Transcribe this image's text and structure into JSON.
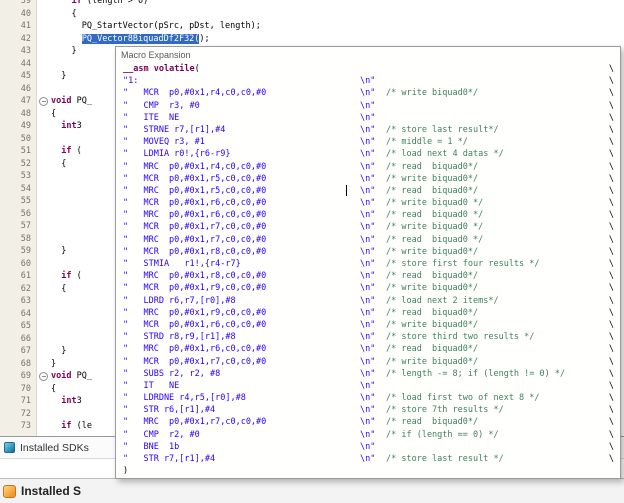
{
  "colors": {
    "keyword": "#7F0055",
    "string": "#2A00FF",
    "comment": "#3F7F5F",
    "selection": "#316AC5",
    "selection_text": "#FFFFFF"
  },
  "editor": {
    "lines": [
      {
        "n": 39,
        "seg": [
          [
            "    "
          ],
          [
            "if",
            "kw"
          ],
          [
            " (length > 0)"
          ]
        ]
      },
      {
        "n": 40,
        "seg": [
          [
            "    {"
          ]
        ]
      },
      {
        "n": 41,
        "seg": [
          [
            "      PQ_StartVector(pSrc, pDst, length);"
          ]
        ]
      },
      {
        "n": 42,
        "seg": [
          [
            "      "
          ],
          [
            "PQ_Vector8BiquadDf2F32(",
            "sel"
          ],
          [
            ");"
          ]
        ]
      },
      {
        "n": 43,
        "seg": [
          [
            "    }"
          ]
        ]
      },
      {
        "n": 44,
        "seg": []
      },
      {
        "n": 45,
        "seg": [
          [
            "  }"
          ]
        ]
      },
      {
        "n": 46,
        "seg": []
      },
      {
        "n": 47,
        "fold": true,
        "seg": [
          [
            "void",
            "kw"
          ],
          [
            " PQ_"
          ]
        ]
      },
      {
        "n": 48,
        "seg": [
          [
            "{"
          ]
        ]
      },
      {
        "n": 49,
        "seg": [
          [
            "  "
          ],
          [
            "int",
            "kw"
          ],
          [
            "3"
          ]
        ]
      },
      {
        "n": 50,
        "seg": []
      },
      {
        "n": 51,
        "seg": [
          [
            "  "
          ],
          [
            "if",
            "kw"
          ],
          [
            " ("
          ]
        ]
      },
      {
        "n": 52,
        "seg": [
          [
            "  {"
          ]
        ]
      },
      {
        "n": 53,
        "seg": []
      },
      {
        "n": 54,
        "seg": []
      },
      {
        "n": 55,
        "seg": []
      },
      {
        "n": 56,
        "seg": []
      },
      {
        "n": 57,
        "seg": []
      },
      {
        "n": 58,
        "seg": []
      },
      {
        "n": 59,
        "seg": [
          [
            "  }"
          ]
        ]
      },
      {
        "n": 60,
        "seg": []
      },
      {
        "n": 61,
        "seg": [
          [
            "  "
          ],
          [
            "if",
            "kw"
          ],
          [
            " ("
          ]
        ]
      },
      {
        "n": 62,
        "seg": [
          [
            "  {"
          ]
        ]
      },
      {
        "n": 63,
        "seg": []
      },
      {
        "n": 64,
        "seg": []
      },
      {
        "n": 65,
        "seg": []
      },
      {
        "n": 66,
        "seg": []
      },
      {
        "n": 67,
        "seg": [
          [
            "  }"
          ]
        ]
      },
      {
        "n": 68,
        "seg": [
          [
            "}"
          ]
        ]
      },
      {
        "n": 69,
        "fold": true,
        "seg": [
          [
            "void",
            "kw"
          ],
          [
            " PQ_"
          ]
        ]
      },
      {
        "n": 70,
        "seg": [
          [
            "{"
          ]
        ]
      },
      {
        "n": 71,
        "seg": [
          [
            "  "
          ],
          [
            "int",
            "kw"
          ],
          [
            "3"
          ]
        ]
      },
      {
        "n": 72,
        "seg": []
      },
      {
        "n": 73,
        "seg": [
          [
            "  "
          ],
          [
            "if",
            "kw"
          ],
          [
            " (le"
          ]
        ]
      }
    ]
  },
  "popup": {
    "title": "Macro Expansion",
    "head": {
      "seg": [
        [
          "__asm",
          "kw"
        ],
        [
          " "
        ],
        [
          "volatile",
          "kw"
        ],
        [
          "("
        ]
      ]
    },
    "nl": "\\n\"",
    "cont": "\\",
    "close": ")",
    "lines": [
      {
        "s": "\"1:",
        "c": ""
      },
      {
        "s": "\"   MCR  p0,#0x1,r4,c0,c0,#0",
        "c": "/* write biquad0*/"
      },
      {
        "s": "\"   CMP  r3, #0",
        "c": ""
      },
      {
        "s": "\"   ITE  NE",
        "c": ""
      },
      {
        "s": "\"   STRNE r7,[r1],#4",
        "c": "/* store last result*/"
      },
      {
        "s": "\"   MOVEQ r3, #1",
        "c": "/* middle = 1 */"
      },
      {
        "s": "\"   LDMIA r0!,{r6-r9}",
        "c": "/* load next 4 datas */"
      },
      {
        "s": "\"   MRC  p0,#0x1,r4,c0,c0,#0",
        "c": "/* read  biquad0*/"
      },
      {
        "s": "\"   MCR  p0,#0x1,r5,c0,c0,#0",
        "c": "/* write biquad0*/"
      },
      {
        "s": "\"   MRC  p0,#0x1,r5,c0,c0,#0",
        "c": "/* read  biquad0*/"
      },
      {
        "s": "\"   MCR  p0,#0x1,r6,c0,c0,#0",
        "c": "/* write biquad0 */"
      },
      {
        "s": "\"   MRC  p0,#0x1,r6,c0,c0,#0",
        "c": "/* read  biquad0 */"
      },
      {
        "s": "\"   MCR  p0,#0x1,r7,c0,c0,#0",
        "c": "/* write biquad0 */"
      },
      {
        "s": "\"   MRC  p0,#0x1,r7,c0,c0,#0",
        "c": "/* read  biquad0 */"
      },
      {
        "s": "\"   MCR  p0,#0x1,r8,c0,c0,#0",
        "c": "/* write biquad0*/"
      },
      {
        "s": "\"   STMIA   r1!,{r4-r7}",
        "c": "/* store first four results */"
      },
      {
        "s": "\"   MRC  p0,#0x1,r8,c0,c0,#0",
        "c": "/* read  biquad0*/"
      },
      {
        "s": "\"   MCR  p0,#0x1,r9,c0,c0,#0",
        "c": "/* write biquad0*/"
      },
      {
        "s": "\"   LDRD r6,r7,[r0],#8",
        "c": "/* load next 2 items*/"
      },
      {
        "s": "\"   MRC  p0,#0x1,r9,c0,c0,#0",
        "c": "/* read  biquad0*/"
      },
      {
        "s": "\"   MCR  p0,#0x1,r6,c0,c0,#0",
        "c": "/* write biquad0*/"
      },
      {
        "s": "\"   STRD r8,r9,[r1],#8",
        "c": "/* store third two results */"
      },
      {
        "s": "\"   MRC  p0,#0x1,r6,c0,c0,#0",
        "c": "/* read  biquad0*/"
      },
      {
        "s": "\"   MCR  p0,#0x1,r7,c0,c0,#0",
        "c": "/* write biquad0*/"
      },
      {
        "s": "\"   SUBS r2, r2, #8",
        "c": "/* length -= 8; if (length != 0) */"
      },
      {
        "s": "\"   IT   NE",
        "c": ""
      },
      {
        "s": "\"   LDRDNE r4,r5,[r0],#8",
        "c": "/* load first two of next 8 */"
      },
      {
        "s": "\"   STR r6,[r1],#4",
        "c": "/* store 7th results */"
      },
      {
        "s": "\"   MRC  p0,#0x1,r7,c0,c0,#0",
        "c": "/* read  biquad0*/"
      },
      {
        "s": "\"   CMP  r2, #0",
        "c": "/* if (length == 0) */"
      },
      {
        "s": "\"   BNE  1b",
        "c": ""
      },
      {
        "s": "\"   STR r7,[r1],#4",
        "c": "/* store last result */"
      }
    ]
  },
  "bottom": {
    "tab1": "Installed SDKs",
    "tab2": "Installed S"
  }
}
